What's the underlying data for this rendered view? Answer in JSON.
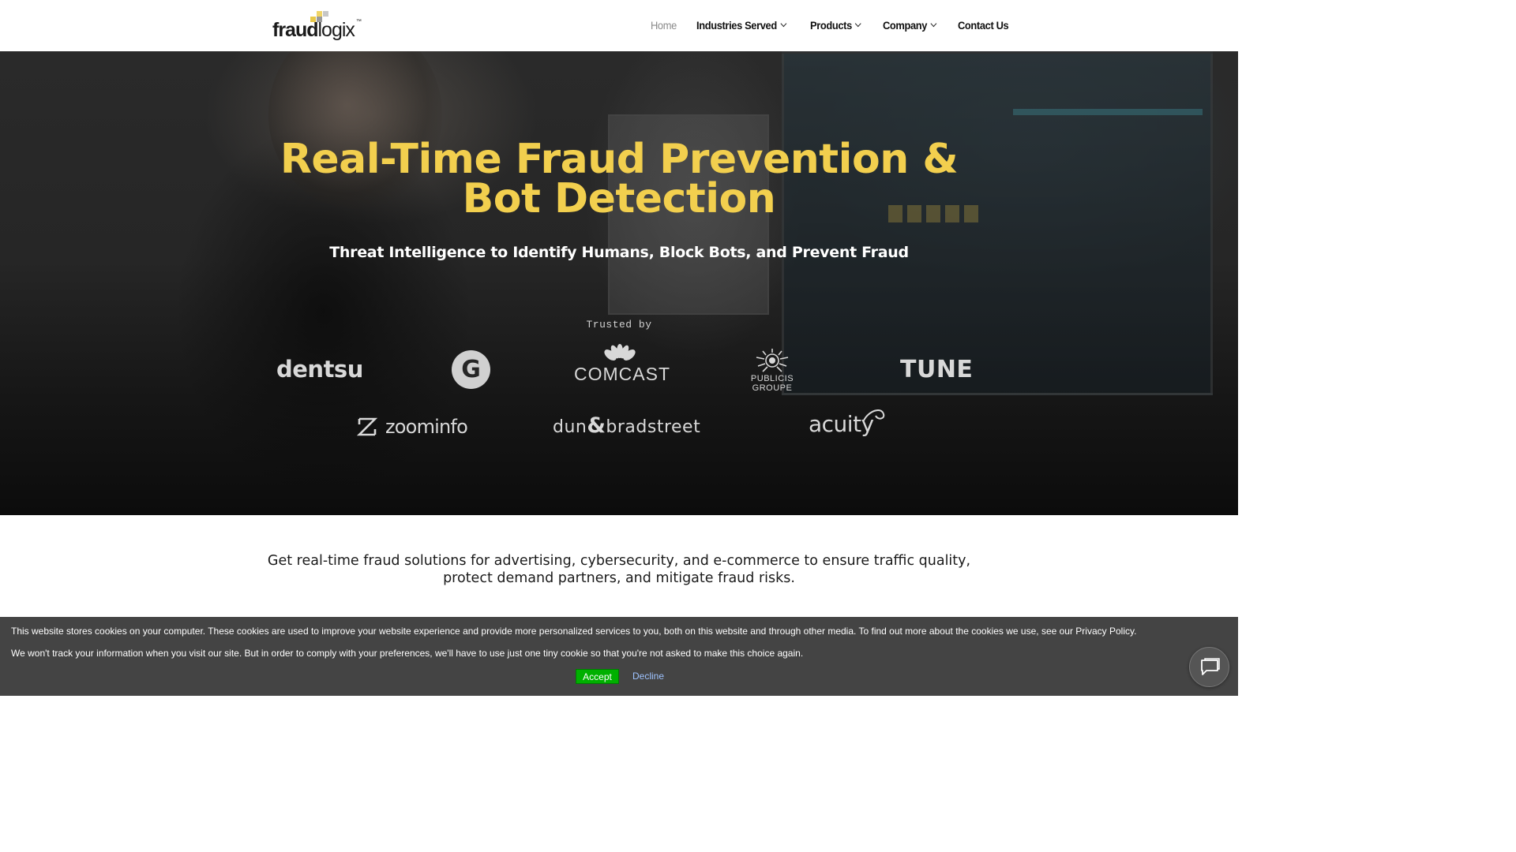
{
  "header": {
    "logo": {
      "part1": "fraud",
      "part2": "logix",
      "tm": "™"
    },
    "nav": [
      {
        "label": "Home",
        "active": true,
        "dropdown": false
      },
      {
        "label": "Industries Served",
        "active": false,
        "dropdown": true
      },
      {
        "label": "Products",
        "active": false,
        "dropdown": true
      },
      {
        "label": "Company",
        "active": false,
        "dropdown": true
      },
      {
        "label": "Contact Us",
        "active": false,
        "dropdown": false
      }
    ]
  },
  "hero": {
    "title_line1": "Real-Time Fraud Prevention &",
    "title_line2": "Bot Detection",
    "subtitle": "Threat Intelligence to Identify Humans, Block Bots, and Prevent Fraud",
    "trusted_label": "Trusted by",
    "logos": {
      "dentsu": "dentsu",
      "g_mark": "G",
      "comcast": "COMCAST",
      "publicis_1": "PUBLICIS",
      "publicis_2": "GROUPE",
      "tune": "TUNE",
      "zoominfo": "zoominfo",
      "dnb_1": "dun",
      "dnb_amp": "&",
      "dnb_2": "bradstreet",
      "acuity": "acuity"
    },
    "title_color": "#f2cf4e"
  },
  "intro": {
    "line1": "Get real-time fraud solutions for advertising, cybersecurity, and e-commerce to ensure traffic quality,",
    "line2": "protect demand partners, and mitigate fraud risks."
  },
  "cookie_banner": {
    "text1": "This website stores cookies on your computer. These cookies are used to improve your website experience and provide more personalized services to you, both on this website and through other media. To find out more about the cookies we use, see our Privacy Policy.",
    "text2": "We won't track your information when you visit our site. But in order to comply with your preferences, we'll have to use just one tiny cookie so that you're not asked to make this choice again.",
    "accept_label": "Accept",
    "decline_label": "Decline"
  },
  "chat": {
    "icon": "chat-bubble-icon"
  }
}
